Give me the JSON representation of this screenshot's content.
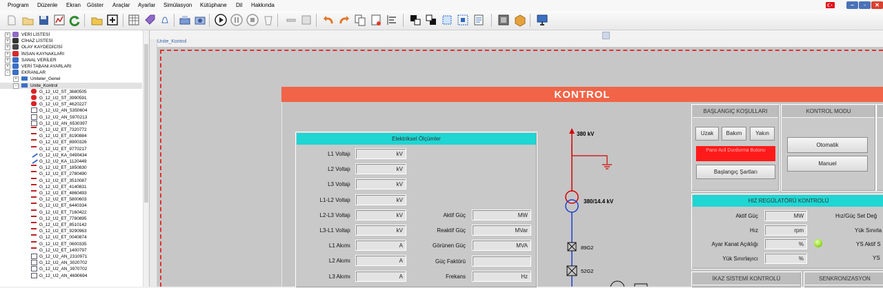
{
  "menu": [
    "Program",
    "Düzenle",
    "Ekran",
    "Göster",
    "Araçlar",
    "Ayarlar",
    "Simülasyon",
    "Kütüphane",
    "Dil",
    "Hakkında"
  ],
  "tree": {
    "roots": [
      {
        "label": "VERİ LİSTESİ",
        "icon": "tag-icon"
      },
      {
        "label": "CİHAZ LİSTESİ",
        "icon": "device-icon"
      },
      {
        "label": "OLAY KAYDEDİCİSİ",
        "icon": "event-icon"
      },
      {
        "label": "İNSAN KAYNAKLARI",
        "icon": "person-icon"
      },
      {
        "label": "SANAL VERİLER",
        "icon": "virtual-data-icon"
      },
      {
        "label": "VERİ TABANI AYARLARI",
        "icon": "database-icon"
      },
      {
        "label": "EKRANLAR",
        "icon": "screens-icon"
      }
    ],
    "screens": [
      {
        "label": "Uniteler_Genel"
      },
      {
        "label": "Unite_Kontrol"
      }
    ],
    "items": [
      {
        "label": "G_12_U2_ST_3680505",
        "icon": "breaker-icon"
      },
      {
        "label": "G_12_U2_ST_3990591",
        "icon": "breaker-icon"
      },
      {
        "label": "G_12_U2_ST_4620227",
        "icon": "breaker-icon"
      },
      {
        "label": "G_12_U2_AN_5350604",
        "icon": "analog-icon"
      },
      {
        "label": "G_12_U2_AN_5970213",
        "icon": "analog-icon"
      },
      {
        "label": "G_12_U2_AN_6530397",
        "icon": "analog-icon"
      },
      {
        "label": "G_12_U2_ET_7320772",
        "icon": "label-icon"
      },
      {
        "label": "G_12_U2_ET_8190884",
        "icon": "label-icon"
      },
      {
        "label": "G_12_U2_ET_8900326",
        "icon": "label-icon"
      },
      {
        "label": "G_12_U2_ET_9770217",
        "icon": "label-icon"
      },
      {
        "label": "G_12_U2_KA_0490434",
        "icon": "line-icon"
      },
      {
        "label": "G_12_U2_KA_1120449",
        "icon": "line-icon"
      },
      {
        "label": "G_12_U2_ET_1850830",
        "icon": "label-icon"
      },
      {
        "label": "G_12_U2_ET_2780490",
        "icon": "label-icon"
      },
      {
        "label": "G_12_U2_ET_3510087",
        "icon": "label-icon"
      },
      {
        "label": "G_12_U2_ET_4140831",
        "icon": "label-icon"
      },
      {
        "label": "G_12_U2_ET_4860493",
        "icon": "label-icon"
      },
      {
        "label": "G_12_U2_ET_5800603",
        "icon": "label-icon"
      },
      {
        "label": "G_12_U2_ET_6440334",
        "icon": "label-icon"
      },
      {
        "label": "G_12_U2_ET_7160422",
        "icon": "label-icon"
      },
      {
        "label": "G_12_U2_ET_7780895",
        "icon": "label-icon"
      },
      {
        "label": "G_12_U2_ET_8510142",
        "icon": "label-icon"
      },
      {
        "label": "G_12_U2_ET_9290963",
        "icon": "label-icon"
      },
      {
        "label": "G_12_U2_ET_0040874",
        "icon": "label-icon"
      },
      {
        "label": "G_12_U2_ET_0600335",
        "icon": "label-icon"
      },
      {
        "label": "G_12_U2_ET_1400797",
        "icon": "label-icon"
      },
      {
        "label": "G_12_U2_AN_2310971",
        "icon": "analog-icon"
      },
      {
        "label": "G_12_U2_AN_3020702",
        "icon": "analog-icon"
      },
      {
        "label": "G_12_U2_AN_3970702",
        "icon": "analog-icon"
      },
      {
        "label": "G_12_U2_AN_4690694",
        "icon": "analog-icon"
      }
    ]
  },
  "doc_tab": "Unite_Kontrol",
  "kontrol": {
    "title": "KONTROL",
    "measurements": {
      "title": "Elektriksel Ölçümler",
      "left": [
        {
          "label": "L1 Voltajı",
          "unit": "kV"
        },
        {
          "label": "L2 Voltajı",
          "unit": "kV"
        },
        {
          "label": "L3 Voltajı",
          "unit": "kV"
        },
        {
          "label": "L1-L2 Voltajı",
          "unit": "kV"
        },
        {
          "label": "L2-L3 Voltajı",
          "unit": "kV"
        },
        {
          "label": "L3-L1 Voltajı",
          "unit": "kV"
        },
        {
          "label": "L1 Akımı",
          "unit": "A"
        },
        {
          "label": "L2 Akımı",
          "unit": "A"
        },
        {
          "label": "L3 Akımı",
          "unit": "A"
        }
      ],
      "right": [
        {
          "label": "Aktif Güç",
          "unit": "MW"
        },
        {
          "label": "Reaktif Güç",
          "unit": "MVar"
        },
        {
          "label": "Görünen Güç",
          "unit": "MVA"
        },
        {
          "label": "Güç Faktörü",
          "unit": ""
        },
        {
          "label": "Frekans",
          "unit": "Hz"
        }
      ]
    },
    "diagram": {
      "voltage_top": "380 kV",
      "transformer": "380/14.4 kV",
      "breaker1": "89G2",
      "breaker2": "52G2"
    },
    "start_conditions": {
      "title": "BAŞLANGIÇ KOŞULLARI",
      "buttons": [
        "Uzak",
        "Bakım",
        "Yakın"
      ],
      "alarm": "Pano Acil Durdurma Butonu",
      "conditions_button": "Başlangıç Şartları",
      "alarm_color": "#ff1a1a"
    },
    "control_mode": {
      "title": "KONTROL MODU",
      "buttons": [
        "Otomatik",
        "Manuel"
      ]
    },
    "speed_regulator": {
      "title": "HIZ REGÜLATÖRÜ KONTROLÜ",
      "rows": [
        {
          "label": "Aktif Güç",
          "unit": "MW"
        },
        {
          "label": "Hız",
          "unit": "rpm"
        },
        {
          "label": "Ayar Kanat Açıklığı",
          "unit": "%"
        },
        {
          "label": "Yük Sınırlayıcı",
          "unit": "%"
        }
      ],
      "right_labels": [
        "Hız/Güç Set Değ",
        "Yük Sınırla",
        "YS Aktif S",
        "YS"
      ],
      "indicator_color": "#9be22e"
    },
    "excitation": {
      "title": "İKAZ SİSTEMİ KONTROLÜ"
    },
    "sync": {
      "title": "SENKRONİZASYON"
    }
  },
  "colors": {
    "header": "#f16447",
    "cyan": "#1fd6d3",
    "frame": "#e03030"
  }
}
